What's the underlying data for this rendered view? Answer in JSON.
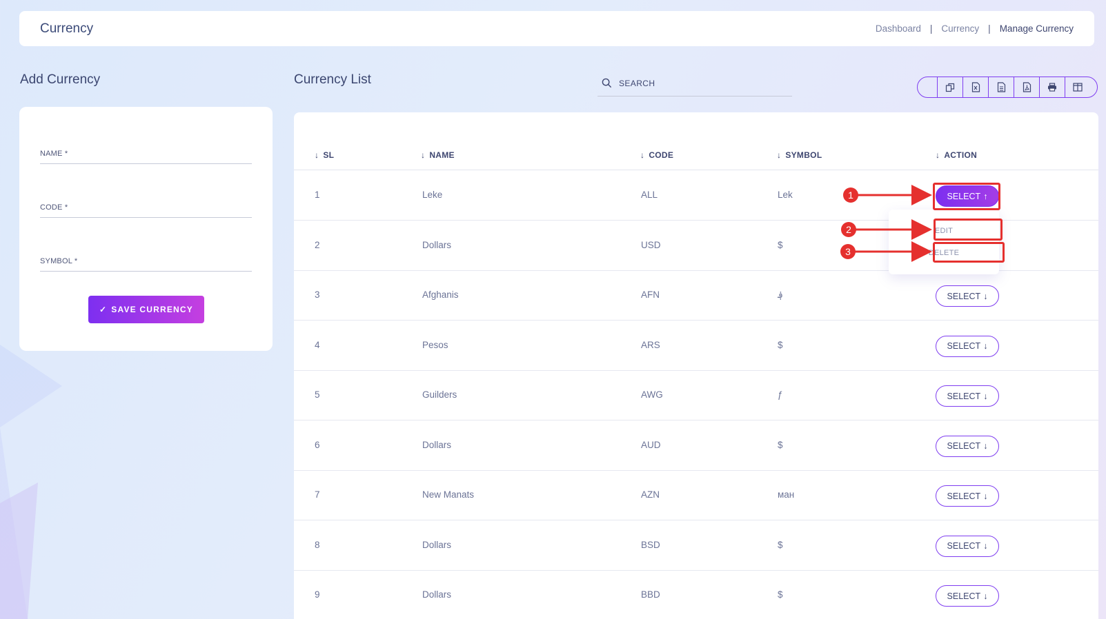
{
  "header": {
    "title": "Currency",
    "breadcrumbs": [
      "Dashboard",
      "Currency",
      "Manage Currency"
    ]
  },
  "form": {
    "title": "Add Currency",
    "fields": [
      {
        "label": "NAME *",
        "value": ""
      },
      {
        "label": "CODE *",
        "value": ""
      },
      {
        "label": "SYMBOL *",
        "value": ""
      }
    ],
    "save_label": "SAVE CURRENCY"
  },
  "list": {
    "title": "Currency List",
    "search_placeholder": "SEARCH",
    "toolbar_icons": [
      "copy-icon",
      "excel-icon",
      "csv-icon",
      "pdf-icon",
      "print-icon",
      "columns-icon"
    ],
    "columns": [
      "SL",
      "NAME",
      "CODE",
      "SYMBOL",
      "ACTION"
    ],
    "rows": [
      {
        "sl": "1",
        "name": "Leke",
        "code": "ALL",
        "symbol": "Lek"
      },
      {
        "sl": "2",
        "name": "Dollars",
        "code": "USD",
        "symbol": "$"
      },
      {
        "sl": "3",
        "name": "Afghanis",
        "code": "AFN",
        "symbol": "؋"
      },
      {
        "sl": "4",
        "name": "Pesos",
        "code": "ARS",
        "symbol": "$"
      },
      {
        "sl": "5",
        "name": "Guilders",
        "code": "AWG",
        "symbol": "ƒ"
      },
      {
        "sl": "6",
        "name": "Dollars",
        "code": "AUD",
        "symbol": "$"
      },
      {
        "sl": "7",
        "name": "New Manats",
        "code": "AZN",
        "symbol": "ман"
      },
      {
        "sl": "8",
        "name": "Dollars",
        "code": "BSD",
        "symbol": "$"
      },
      {
        "sl": "9",
        "name": "Dollars",
        "code": "BBD",
        "symbol": "$"
      }
    ],
    "select_label": "SELECT",
    "dropdown": {
      "edit_label": "EDIT",
      "delete_label": "DELETE"
    }
  },
  "annotations": {
    "numbers": [
      "1",
      "2",
      "3"
    ],
    "color": "#e5302e"
  },
  "colors": {
    "accent": "#7d2ff0",
    "accent_end": "#c53fe0"
  }
}
